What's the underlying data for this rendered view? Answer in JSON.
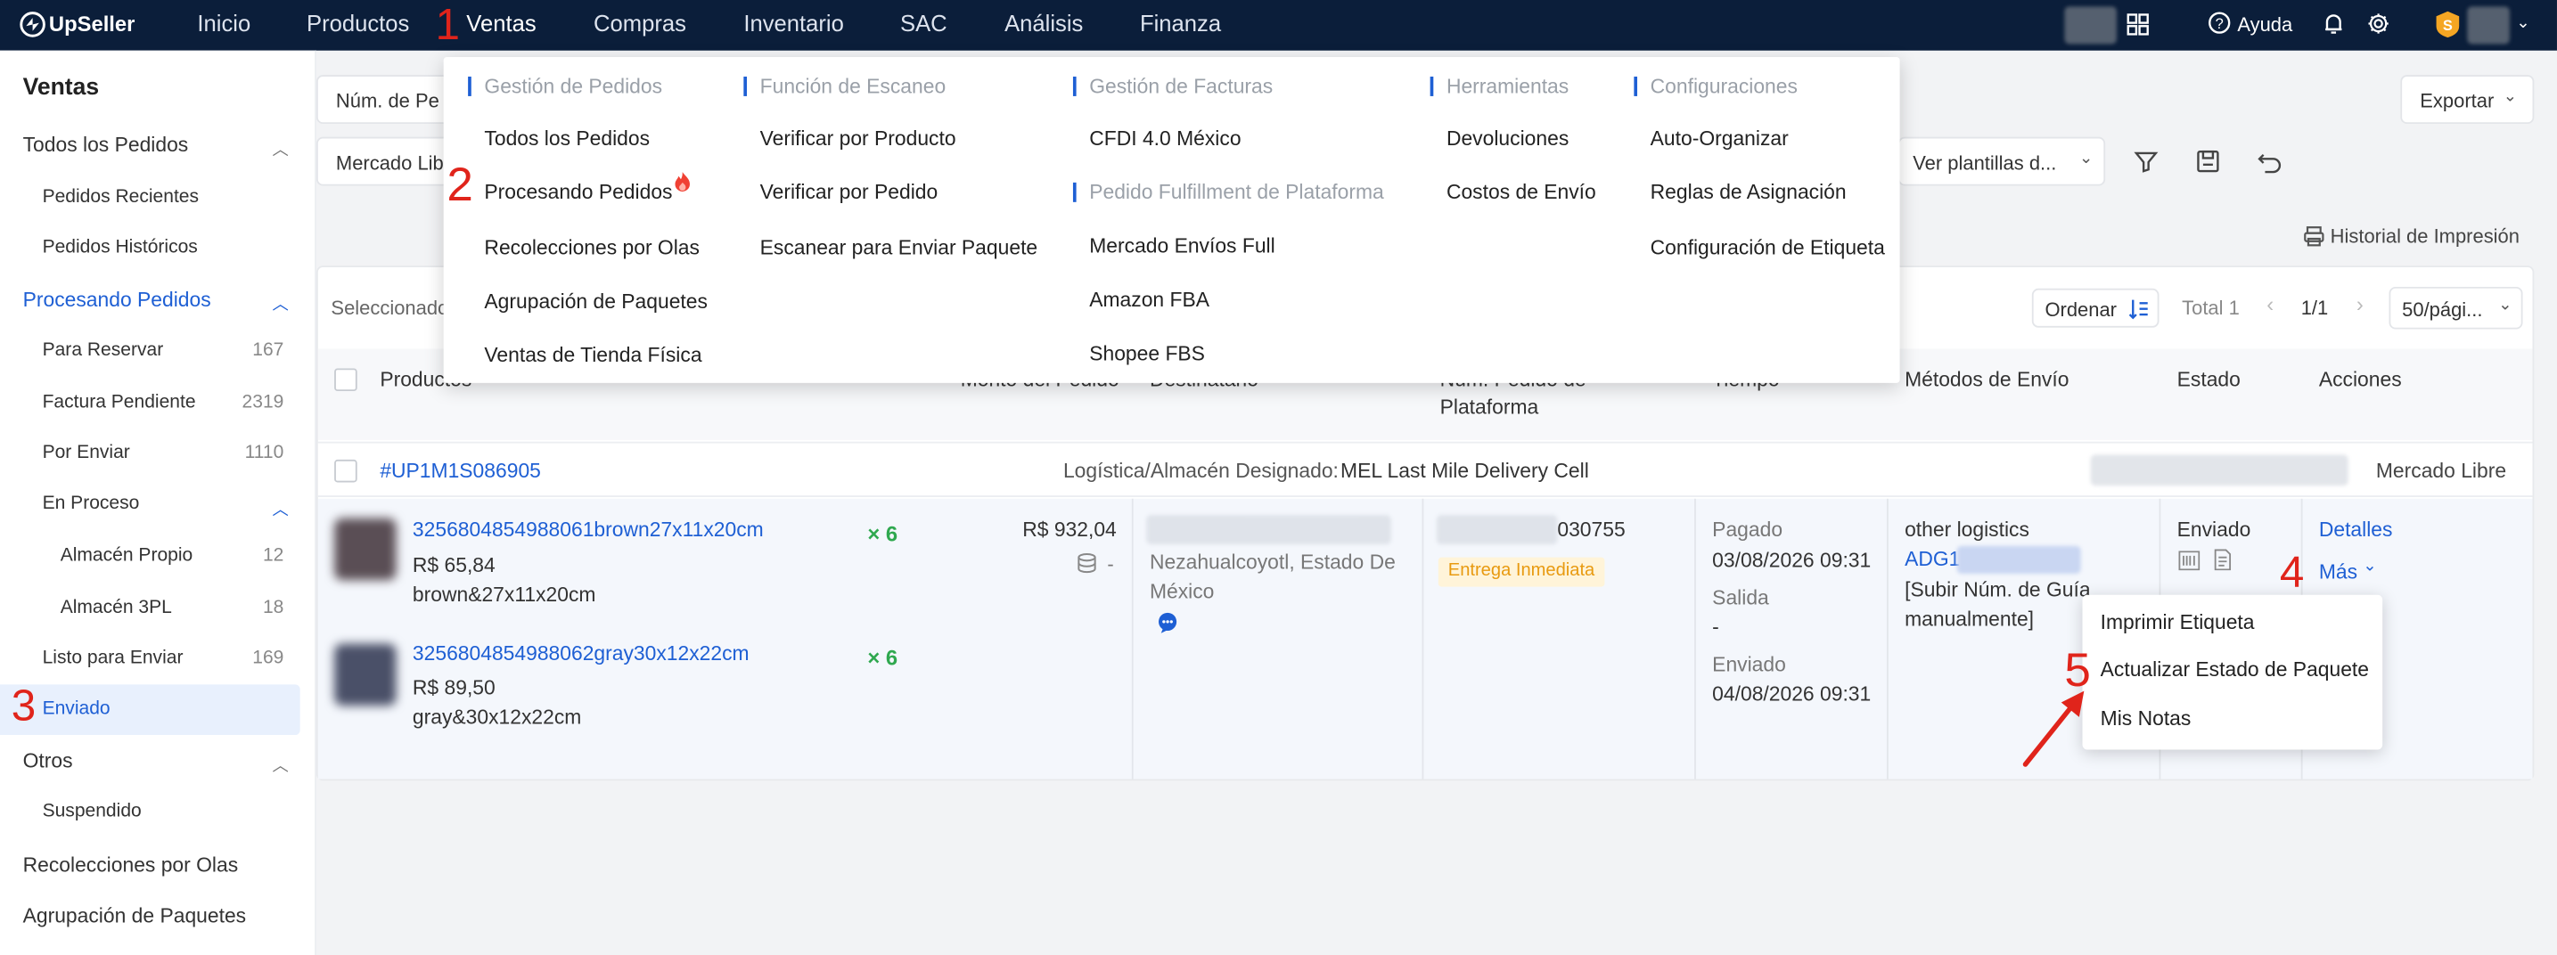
{
  "topbar": {
    "logo": "UpSeller",
    "nav": [
      "Inicio",
      "Productos",
      "Ventas",
      "Compras",
      "Inventario",
      "SAC",
      "Análisis",
      "Finanza"
    ],
    "help": "Ayuda"
  },
  "sidebar": {
    "title": "Ventas",
    "todos": "Todos los Pedidos",
    "recientes": "Pedidos Recientes",
    "historicos": "Pedidos Históricos",
    "procesando": "Procesando Pedidos",
    "reservar": {
      "label": "Para Reservar",
      "count": "167"
    },
    "factura": {
      "label": "Factura Pendiente",
      "count": "2319"
    },
    "enviar": {
      "label": "Por Enviar",
      "count": "1110"
    },
    "enproceso": "En Proceso",
    "almacen_propio": {
      "label": "Almacén Propio",
      "count": "12"
    },
    "almacen_3pl": {
      "label": "Almacén 3PL",
      "count": "18"
    },
    "listo": {
      "label": "Listo para Enviar",
      "count": "169"
    },
    "enviado": "Enviado",
    "otros": "Otros",
    "suspendido": "Suspendido",
    "olas": "Recolecciones por Olas",
    "agrupacion": "Agrupación de Paquetes"
  },
  "filters": {
    "num_pedido": "Núm. de Pe",
    "mercado": "Mercado Libr",
    "exportar": "Exportar",
    "plantillas": "Ver plantillas d...",
    "historial": "Historial de Impresión"
  },
  "toolbar": {
    "seleccionado": "Seleccionado",
    "ordenar": "Ordenar",
    "total": "Total 1",
    "page": "1/1",
    "per_page": "50/pági..."
  },
  "table": {
    "headers": {
      "productos": "Productos",
      "monto": "Monto del Pedido",
      "destinatario": "Destinatario",
      "num_plat_1": "Núm. Pedido de",
      "num_plat_2": "Plataforma",
      "tiempo": "Tiempo",
      "metodos": "Métodos de Envío",
      "estado": "Estado",
      "acciones": "Acciones"
    },
    "order": {
      "id": "#UP1M1S086905",
      "logistics_label": "Logística/Almacén Designado:",
      "logistics_value": "MEL Last Mile Delivery Cell",
      "platform": "Mercado Libre"
    },
    "products": [
      {
        "sku": "3256804854988061brown27x11x20cm",
        "price": "R$ 65,84",
        "variant": "brown&27x11x20cm",
        "qty": "× 6"
      },
      {
        "sku": "3256804854988062gray30x12x22cm",
        "price": "R$ 89,50",
        "variant": "gray&30x12x22cm",
        "qty": "× 6"
      }
    ],
    "amount": "R$ 932,04",
    "amount_sub": "-",
    "address_1": "Nezahualcoyotl, Estado De",
    "address_2": "México",
    "platform_num_suffix": "030755",
    "badge": "Entrega Inmediata",
    "pagado_label": "Pagado",
    "pagado_value": "03/08/2026 09:31",
    "salida_label": "Salida",
    "salida_value": "-",
    "enviado_label": "Enviado",
    "enviado_value": "04/08/2026 09:31",
    "shipping_method": "other logistics",
    "shipping_code": "ADG1",
    "shipping_note_1": "[Subir Núm. de Guía",
    "shipping_note_2": "manualmente]",
    "estado": "Enviado",
    "detalles": "Detalles",
    "mas": "Más"
  },
  "mega_menu": {
    "h_gestion": "Gestión de Pedidos",
    "h_escaneo": "Función de Escaneo",
    "h_facturas": "Gestión de Facturas",
    "h_fulfillment": "Pedido Fulfillment de Plataforma",
    "h_herramientas": "Herramientas",
    "h_config": "Configuraciones",
    "todos": "Todos los Pedidos",
    "procesando": "Procesando Pedidos",
    "olas": "Recolecciones por Olas",
    "agrupacion": "Agrupación de Paquetes",
    "tienda": "Ventas de Tienda Física",
    "verif_producto": "Verificar por Producto",
    "verif_pedido": "Verificar por Pedido",
    "escanear": "Escanear para Enviar Paquete",
    "cfdi": "CFDI 4.0 México",
    "envios_full": "Mercado Envíos Full",
    "amazon": "Amazon FBA",
    "shopee": "Shopee FBS",
    "devoluciones": "Devoluciones",
    "costos": "Costos de Envío",
    "auto": "Auto-Organizar",
    "reglas": "Reglas de Asignación",
    "etiqueta": "Configuración de Etiqueta"
  },
  "more_menu": [
    "Imprimir Etiqueta",
    "Actualizar Estado de Paquete",
    "Mis Notas"
  ],
  "step_numbers": [
    "1",
    "2",
    "3",
    "4",
    "5"
  ],
  "colors": {
    "topbar": "#0b1e3a",
    "accent": "#1e5fd4",
    "annotation": "#e0241b",
    "qty": "#2fa84f"
  }
}
